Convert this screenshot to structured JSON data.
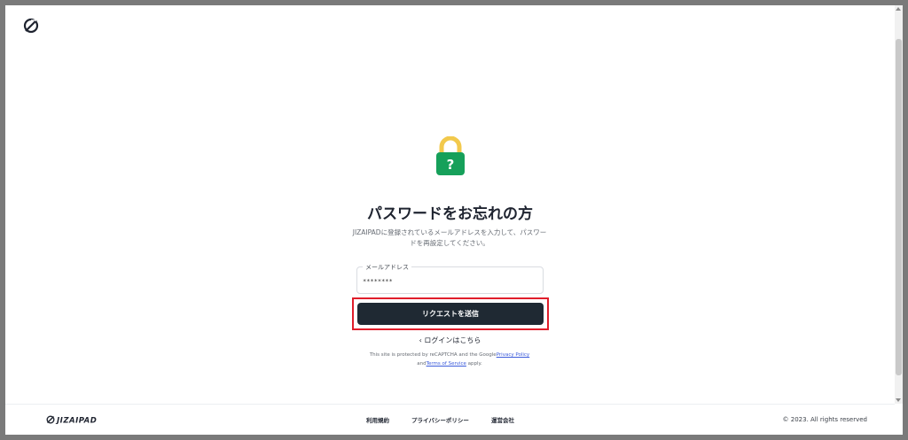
{
  "header": {
    "logo_icon": "jizaipad-logo-icon"
  },
  "main": {
    "lock_icon": "padlock-question-icon",
    "title": "パスワードをお忘れの方",
    "description": "JIZAIPADに登録されているメールアドレスを入力して、パスワードを再設定してください。",
    "email_label": "メールアドレス",
    "email_value": "********",
    "submit_label": "リクエストを送信",
    "login_link": "‹ ログインはこちら",
    "recaptcha": {
      "text1": "This site is protected by reCAPTCHA and the Google",
      "privacy_link": "Privacy Policy",
      "text2": "and",
      "terms_link": "Terms of Service",
      "text3": " apply."
    }
  },
  "footer": {
    "logo_text": "JIZAIPAD",
    "links": [
      "利用規約",
      "プライバシーポリシー",
      "運営会社"
    ],
    "copyright": "© 2023. All rights reserved"
  },
  "colors": {
    "button_bg": "#1f2933",
    "highlight": "#e01e2b",
    "lock_shackle": "#f2c94c",
    "lock_body": "#16a05a",
    "link": "#3b5bdb"
  }
}
